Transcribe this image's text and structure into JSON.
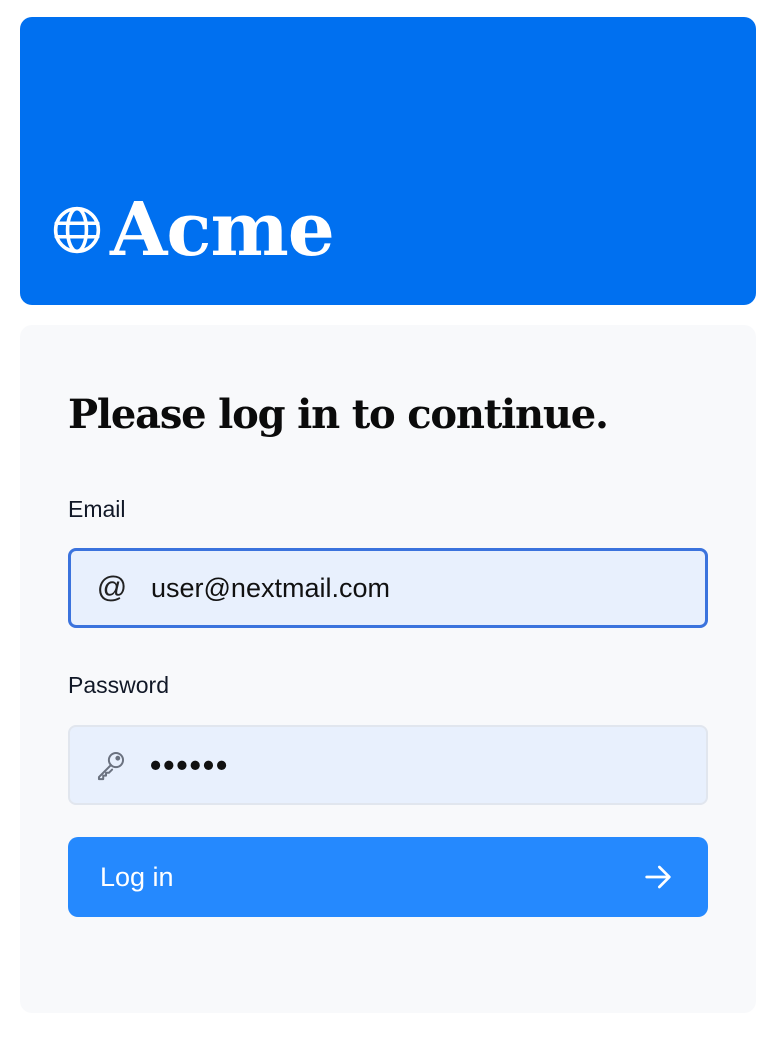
{
  "brand": {
    "name": "Acme",
    "icon": "globe-icon",
    "color": "#0070f0"
  },
  "login_form": {
    "heading": "Please log in to continue.",
    "email": {
      "label": "Email",
      "value": "user@nextmail.com",
      "icon": "at-icon"
    },
    "password": {
      "label": "Password",
      "masked_value": "••••••",
      "icon": "key-icon"
    },
    "submit": {
      "label": "Log in",
      "icon": "arrow-right-icon",
      "color": "#2589fe"
    }
  }
}
